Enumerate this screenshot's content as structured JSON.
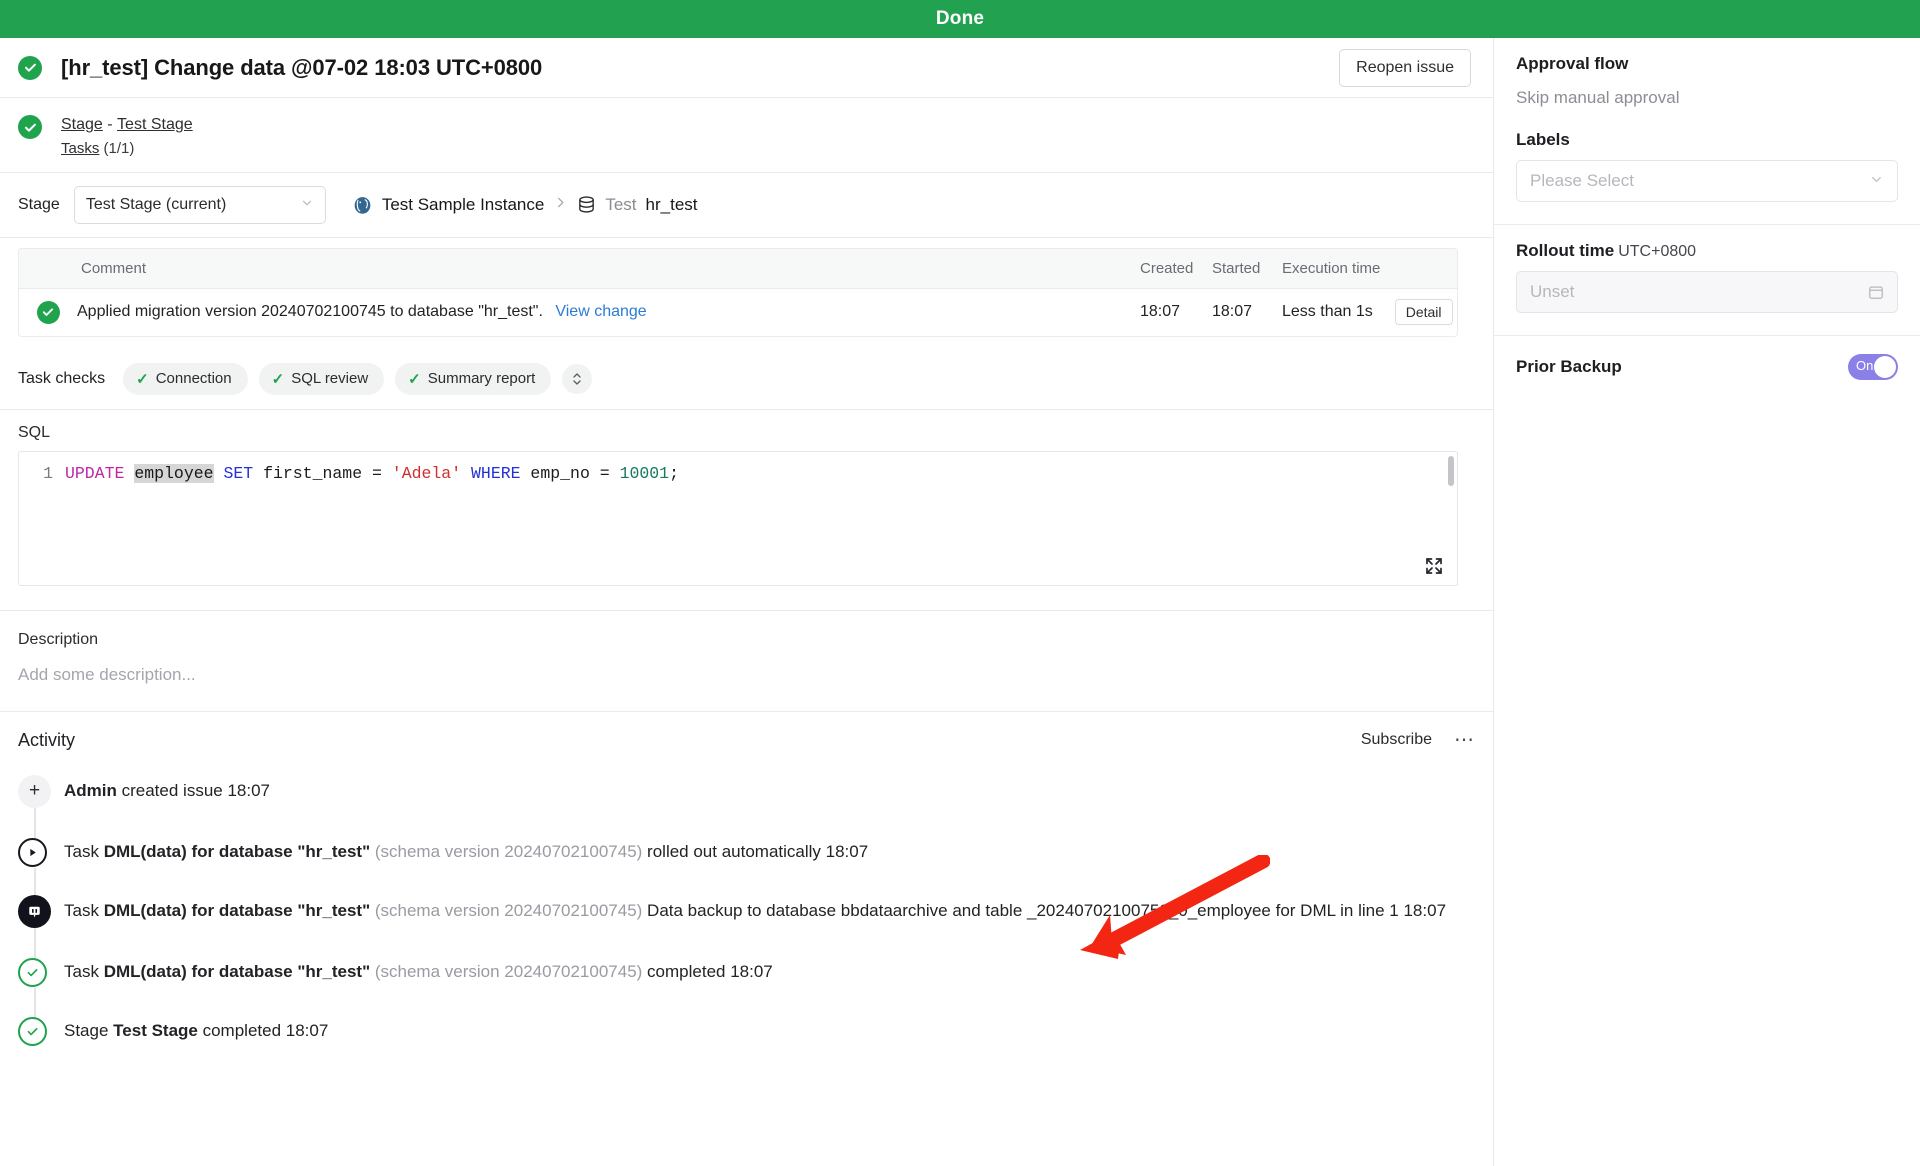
{
  "banner": {
    "status": "Done"
  },
  "header": {
    "title": "[hr_test] Change data @07-02 18:03 UTC+0800",
    "reopen_label": "Reopen issue",
    "status_icon": "check-circle-icon"
  },
  "stage_strip": {
    "stage_link": "Stage",
    "separator": "-",
    "stage_name_link": "Test Stage",
    "tasks_link": "Tasks",
    "tasks_count": "(1/1)"
  },
  "stage_selector": {
    "label": "Stage",
    "selected": "Test Stage (current)",
    "breadcrumb": {
      "instance": "Test Sample Instance",
      "db_prefix": "Test",
      "db_name": "hr_test"
    }
  },
  "task_table": {
    "columns": [
      "Comment",
      "Created",
      "Started",
      "Execution time"
    ],
    "rows": [
      {
        "status_icon": "check-circle-icon",
        "comment": "Applied migration version 20240702100745 to database \"hr_test\".",
        "link": "View change",
        "created": "18:07",
        "started": "18:07",
        "execution_time": "Less than 1s",
        "detail_label": "Detail"
      }
    ]
  },
  "task_checks": {
    "label": "Task checks",
    "items": [
      "Connection",
      "SQL review",
      "Summary report"
    ],
    "expand_icon": "chevron-up-down-icon"
  },
  "sql": {
    "label": "SQL",
    "line_number": "1",
    "tokens": [
      {
        "t": "UPDATE",
        "c": "kw-magenta"
      },
      {
        "t": " ",
        "c": "code-plain"
      },
      {
        "t": "employee",
        "c": "tbl-hl"
      },
      {
        "t": " ",
        "c": "code-plain"
      },
      {
        "t": "SET",
        "c": "kw-blue"
      },
      {
        "t": " first_name = ",
        "c": "code-plain"
      },
      {
        "t": "'Adela'",
        "c": "str-red"
      },
      {
        "t": " ",
        "c": "code-plain"
      },
      {
        "t": "WHERE",
        "c": "kw-blue"
      },
      {
        "t": " emp_no = ",
        "c": "code-plain"
      },
      {
        "t": "10001",
        "c": "num-green"
      },
      {
        "t": ";",
        "c": "code-plain"
      }
    ],
    "expand_icon": "fullscreen-icon"
  },
  "description": {
    "label": "Description",
    "placeholder": "Add some description..."
  },
  "activity": {
    "title": "Activity",
    "subscribe_label": "Subscribe",
    "more_icon": "ellipsis-icon",
    "items": [
      {
        "icon": "plus-icon",
        "actor": "Admin",
        "rest": " created issue 18:07",
        "schema": "",
        "tail": ""
      },
      {
        "icon": "play-circle-icon",
        "prefix": "Task ",
        "bold": "DML(data) for database \"hr_test\"",
        "schema": " (schema version 20240702100745)",
        "tail": " rolled out automatically 18:07"
      },
      {
        "icon": "bytebase-logo-icon",
        "prefix": "Task ",
        "bold": "DML(data) for database \"hr_test\"",
        "schema": " (schema version 20240702100745)",
        "tail": " Data backup to database bbdataarchive and table _20240702100750_0_employee for DML in line 1 18:07"
      },
      {
        "icon": "check-circle-outline-icon",
        "prefix": "Task ",
        "bold": "DML(data) for database \"hr_test\"",
        "schema": " (schema version 20240702100745)",
        "tail": " completed 18:07"
      },
      {
        "icon": "check-circle-outline-icon",
        "prefix": "Stage ",
        "bold": "Test Stage",
        "schema": "",
        "tail": " completed 18:07"
      }
    ]
  },
  "sidebar": {
    "approval_flow_title": "Approval flow",
    "approval_flow_value": "Skip manual approval",
    "labels_title": "Labels",
    "labels_placeholder": "Please Select",
    "rollout_title": "Rollout time",
    "rollout_tz": "UTC+0800",
    "rollout_value": "Unset",
    "prior_backup_label": "Prior Backup",
    "prior_backup_state": "On"
  },
  "colors": {
    "success_green": "#22a251",
    "link_blue": "#2b7cd3",
    "toggle_purple": "#8b7fe8",
    "annotation_red": "#f22613"
  }
}
